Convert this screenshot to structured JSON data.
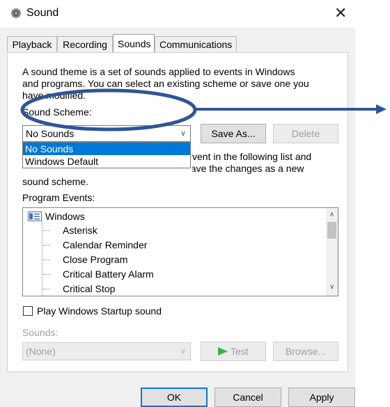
{
  "window": {
    "title": "Sound"
  },
  "tabs": [
    {
      "label": "Playback"
    },
    {
      "label": "Recording"
    },
    {
      "label": "Sounds"
    },
    {
      "label": "Communications"
    }
  ],
  "description": {
    "line1": "A sound theme is a set of sounds applied to events in Windows",
    "line2": "and programs. You can select an existing scheme or save one you",
    "line3": "have modified."
  },
  "scheme": {
    "label": "Sound Scheme:",
    "selected": "No Sounds",
    "options": [
      "No Sounds",
      "Windows Default"
    ],
    "save_as": "Save As...",
    "delete": "Delete"
  },
  "instructions": {
    "line1_end": "vent in the following list and",
    "line2": "then select a sound to apply. You can save the changes as a new",
    "line3": "sound scheme."
  },
  "events": {
    "label": "Program Events:",
    "root": "Windows",
    "items": [
      "Asterisk",
      "Calendar Reminder",
      "Close Program",
      "Critical Battery Alarm",
      "Critical Stop"
    ]
  },
  "startup": {
    "label": "Play Windows Startup sound",
    "checked": false
  },
  "sounds": {
    "label": "Sounds:",
    "value": "(None)",
    "test": "Test",
    "browse": "Browse..."
  },
  "footer": {
    "ok": "OK",
    "cancel": "Cancel",
    "apply": "Apply"
  },
  "colors": {
    "selection": "#0078d7",
    "annotation": "#2f5597",
    "play_arrow": "#3cb043"
  },
  "icons": {
    "title": "speaker-icon",
    "root": "windows-folder-icon",
    "test": "play-icon"
  }
}
